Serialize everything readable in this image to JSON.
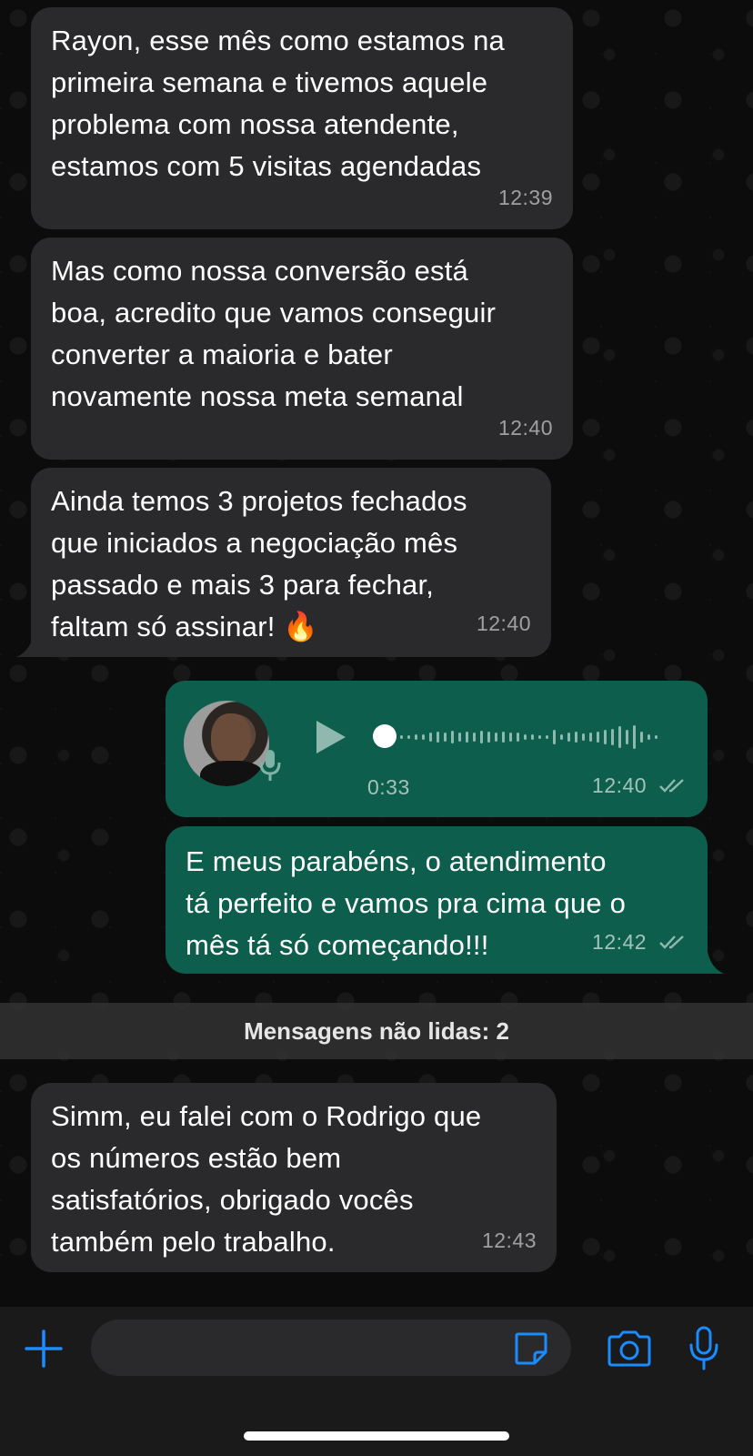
{
  "messages": [
    {
      "id": "m1",
      "direction": "incoming",
      "text": "Rayon, esse mês como estamos na\nprimeira semana e tivemos aquele\nproblema com nossa atendente,\nestamos com 5 visitas agendadas",
      "time": "12:39"
    },
    {
      "id": "m2",
      "direction": "incoming",
      "text": "Mas como nossa conversão está\nboa, acredito que vamos conseguir\nconverter a maioria e bater\nnovamente nossa meta semanal",
      "time": "12:40"
    },
    {
      "id": "m3",
      "direction": "incoming",
      "text": "Ainda temos 3 projetos fechados\nque iniciados a negociação mês\npassado e mais 3 para fechar,\nfaltam só assinar!",
      "emoji": "🔥",
      "time": "12:40"
    },
    {
      "id": "m4",
      "direction": "outgoing",
      "type": "voice",
      "duration": "0:33",
      "time": "12:40",
      "read": true
    },
    {
      "id": "m5",
      "direction": "outgoing",
      "text": "E meus parabéns, o atendimento\ntá perfeito e vamos pra cima que o\nmês tá só começando!!!",
      "time": "12:42",
      "read": true
    },
    {
      "id": "m6",
      "direction": "incoming",
      "text": "Simm, eu falei com o Rodrigo que\nos números estão bem\nsatisfatórios, obrigado vocês\ntambém pelo trabalho.",
      "time": "12:43"
    }
  ],
  "unread_divider": "Mensagens não lidas: 2",
  "voice": {
    "progress": 0.0
  },
  "composer": {
    "icons": [
      "plus-icon",
      "sticker-icon",
      "camera-icon",
      "microphone-icon"
    ]
  },
  "colors": {
    "incoming_bubble": "#2a2a2c",
    "outgoing_bubble": "#0e5e4e",
    "accent_blue": "#1a8cff",
    "read_ticks": "#8fb8ae"
  }
}
